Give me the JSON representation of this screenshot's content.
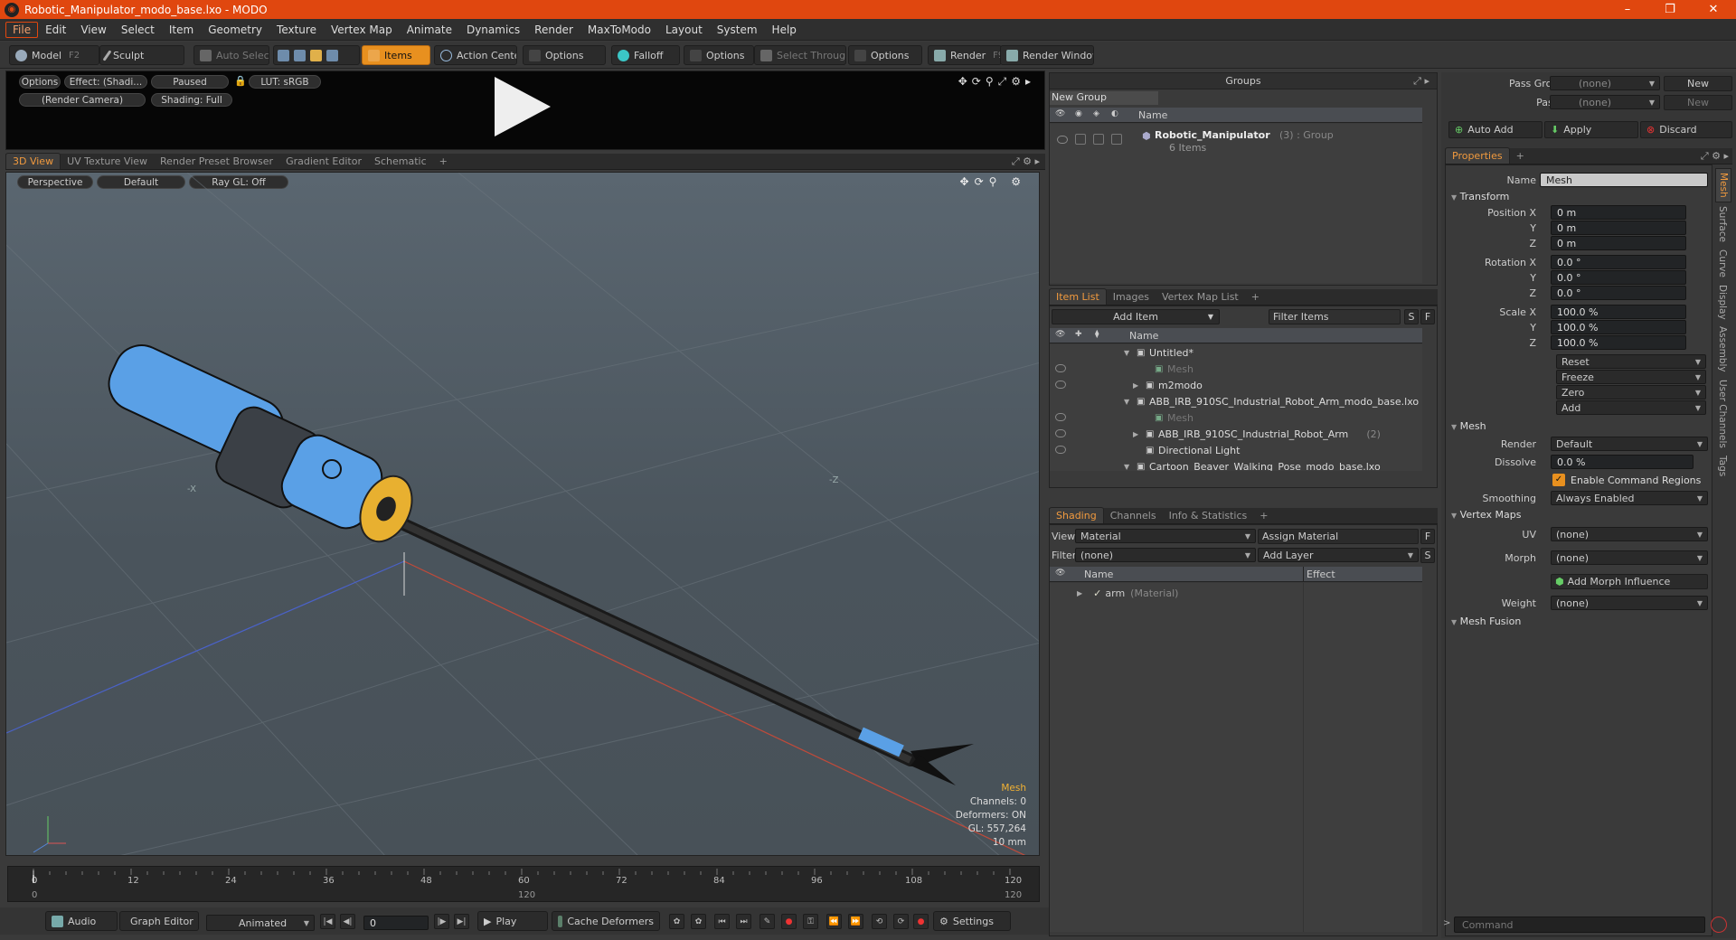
{
  "window": {
    "title": "Robotic_Manipulator_modo_base.lxo - MODO",
    "minimize": "–",
    "restore": "❐",
    "close": "✕"
  },
  "menu": [
    "File",
    "Edit",
    "View",
    "Select",
    "Item",
    "Geometry",
    "Texture",
    "Vertex Map",
    "Animate",
    "Dynamics",
    "Render",
    "MaxToModo",
    "Layout",
    "System",
    "Help"
  ],
  "toolbar": {
    "model": "Model",
    "model_key": "F2",
    "sculpt": "Sculpt",
    "auto_select": "Auto Select",
    "items": "Items",
    "action_center": "Action Center",
    "options1": "Options",
    "falloff": "Falloff",
    "options2": "Options",
    "select_through": "Select Through",
    "options3": "Options",
    "render": "Render",
    "render_key": "F9",
    "render_window": "Render Window"
  },
  "preview": {
    "options": "Options",
    "effect": "Effect: (Shadi...",
    "paused": "Paused",
    "lut": "LUT: sRGB",
    "camera": "(Render Camera)",
    "shading": "Shading: Full"
  },
  "view_tabs": [
    "3D View",
    "UV Texture View",
    "Render Preset Browser",
    "Gradient Editor",
    "Schematic",
    "+"
  ],
  "viewport": {
    "perspective": "Perspective",
    "default": "Default",
    "raygl": "Ray GL: Off",
    "axis_x": "-X",
    "axis_z": "-Z",
    "info": {
      "type": "Mesh",
      "channels": "Channels: 0",
      "deformers": "Deformers: ON",
      "gl": "GL: 557,264",
      "scale": "10 mm"
    }
  },
  "timeline": {
    "ticks": [
      "0",
      "12",
      "24",
      "36",
      "48",
      "60",
      "72",
      "84",
      "96",
      "108",
      "120"
    ],
    "sub_start": "0",
    "sub_mid": "120",
    "sub_end": "120"
  },
  "bottom": {
    "audio": "Audio",
    "graph_editor": "Graph Editor",
    "animated": "Animated",
    "frame": "0",
    "play": "Play",
    "cache": "Cache Deformers",
    "settings": "Settings"
  },
  "groups": {
    "title": "Groups",
    "new_group": "New Group",
    "col_name": "Name",
    "item_name": "Robotic_Manipulator",
    "item_suffix": "(3) : Group",
    "item_count": "6 Items"
  },
  "item_list": {
    "tabs": [
      "Item List",
      "Images",
      "Vertex Map List",
      "+"
    ],
    "add_item": "Add Item",
    "filter": "Filter Items",
    "btn_s": "S",
    "btn_f": "F",
    "col_name": "Name",
    "rows": [
      {
        "label": "Untitled*",
        "indent": 0,
        "arrow": "▼",
        "eye": false,
        "dim": false
      },
      {
        "label": "Mesh",
        "indent": 2,
        "arrow": "",
        "eye": true,
        "dim": true
      },
      {
        "label": "m2modo",
        "indent": 1,
        "arrow": "▶",
        "eye": true,
        "dim": false
      },
      {
        "label": "ABB_IRB_910SC_Industrial_Robot_Arm_modo_base.lxo",
        "indent": 0,
        "arrow": "▼",
        "eye": false,
        "dim": false
      },
      {
        "label": "Mesh",
        "indent": 2,
        "arrow": "",
        "eye": true,
        "dim": true
      },
      {
        "label": "ABB_IRB_910SC_Industrial_Robot_Arm",
        "indent": 1,
        "arrow": "▶",
        "eye": true,
        "dim": false,
        "suffix": "(2)"
      },
      {
        "label": "Directional Light",
        "indent": 1,
        "arrow": "",
        "eye": true,
        "dim": false
      },
      {
        "label": "Cartoon_Beaver_Walking_Pose_modo_base.lxo",
        "indent": 0,
        "arrow": "▼",
        "eye": false,
        "dim": false
      }
    ]
  },
  "shading": {
    "tabs": [
      "Shading",
      "Channels",
      "Info & Statistics",
      "+"
    ],
    "view_label": "View",
    "view_value": "Material",
    "assign": "Assign Material",
    "btn_f": "F",
    "filter_label": "Filter",
    "filter_value": "(none)",
    "add_layer": "Add Layer",
    "btn_s": "S",
    "col_name": "Name",
    "col_effect": "Effect",
    "row_name": "arm",
    "row_suffix": "(Material)"
  },
  "passes": {
    "pass_groups": "Pass Groups",
    "pass_value": "(none)",
    "new1": "New",
    "passes": "Passes",
    "passes_value": "(none)",
    "new2": "New"
  },
  "actions": {
    "auto_add": "Auto Add",
    "apply": "Apply",
    "discard": "Discard"
  },
  "properties": {
    "tab": "Properties",
    "plus": "+",
    "name_label": "Name",
    "name_value": "Mesh",
    "transform": "Transform",
    "position_label": "Position X",
    "px": "0 m",
    "py": "0 m",
    "pz": "0 m",
    "rotation_label": "Rotation X",
    "rx": "0.0 °",
    "ry": "0.0 °",
    "rz": "0.0 °",
    "scale_label": "Scale X",
    "sx": "100.0 %",
    "sy": "100.0 %",
    "sz": "100.0 %",
    "y": "Y",
    "z": "Z",
    "reset": "Reset",
    "freeze": "Freeze",
    "zero": "Zero",
    "add": "Add",
    "mesh": "Mesh",
    "render_label": "Render",
    "render_value": "Default",
    "dissolve_label": "Dissolve",
    "dissolve_value": "0.0 %",
    "enable_cmd": "Enable Command Regions",
    "smoothing_label": "Smoothing",
    "smoothing_value": "Always Enabled",
    "vertex_maps": "Vertex Maps",
    "uv_label": "UV",
    "uv_value": "(none)",
    "morph_label": "Morph",
    "morph_value": "(none)",
    "add_morph": "Add Morph Influence",
    "weight_label": "Weight",
    "weight_value": "(none)",
    "mesh_fusion": "Mesh Fusion"
  },
  "side_tabs": [
    "Mesh",
    "Surface",
    "Curve",
    "Display",
    "Assembly",
    "User Channels",
    "Tags"
  ],
  "command": {
    "placeholder": "Command"
  },
  "colors": {
    "accent": "#e0470f",
    "active_tab": "#f19a3e",
    "mesh_blue": "#5aa0e6",
    "mesh_yellow": "#e8b030"
  }
}
